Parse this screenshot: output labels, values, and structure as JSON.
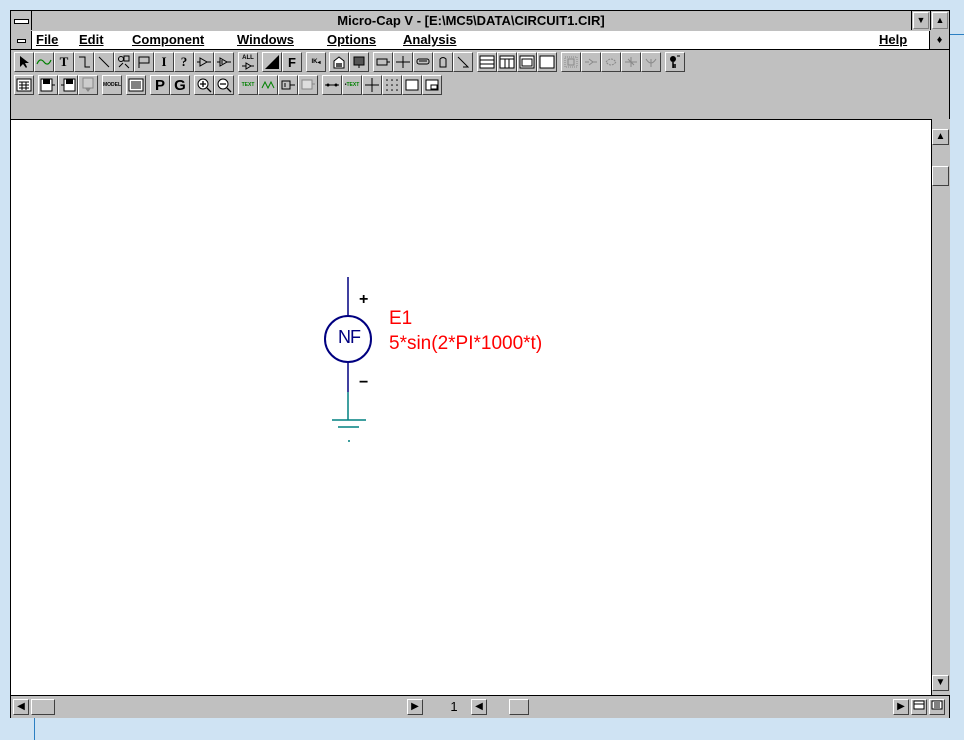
{
  "window": {
    "title": "Micro-Cap V - [E:\\MC5\\DATA\\CIRCUIT1.CIR]"
  },
  "menu": {
    "items": [
      {
        "label": "File"
      },
      {
        "label": "Edit"
      },
      {
        "label": "Component"
      },
      {
        "label": "Windows"
      },
      {
        "label": "Options"
      },
      {
        "label": "Analysis"
      }
    ],
    "help": "Help"
  },
  "toolbar1": {
    "icons": [
      "select-arrow-icon",
      "sine-wave-icon",
      "text-tool-icon",
      "wire-tool-icon",
      "diagonal-wire-icon",
      "component-icon",
      "flag-icon",
      "info-icon",
      "help-icon",
      "buffer-icon",
      "buffer-2-icon",
      "all-icon",
      "display-icon",
      "font-icon",
      "fill-icon",
      "nodes-icon",
      "bus-icon",
      "pin-icon",
      "junction-icon",
      "battery-icon",
      "capacitor-icon",
      "probe-icon",
      "window-1-icon",
      "window-2-icon",
      "window-3-icon",
      "window-4-icon",
      "grid-1-icon",
      "grid-2-icon",
      "grid-3-icon",
      "grid-4-icon",
      "grid-5-icon",
      "key-icon"
    ],
    "labels": {
      "text": "T",
      "info": "I",
      "help": "?",
      "font": "F",
      "all": "ALL",
      "ik": "IK"
    }
  },
  "toolbar2": {
    "icons": [
      "calculator-icon",
      "save-in-icon",
      "save-out-icon",
      "library-icon",
      "model-icon",
      "list-icon",
      "page-p-icon",
      "grid-g-icon",
      "zoom-in-icon",
      "zoom-out-icon",
      "text-a-icon",
      "pin-1-icon",
      "pin-2-icon",
      "image-icon",
      "node-line-icon",
      "text-b-icon",
      "cross-icon",
      "dots-icon",
      "frame-icon",
      "frame-2-icon"
    ],
    "labels": {
      "p": "P",
      "g": "G",
      "model": "MODEL",
      "text": "TEXT"
    }
  },
  "schematic": {
    "component": {
      "symbol": "NF",
      "name": "E1",
      "value": "5*sin(2*PI*1000*t)",
      "plus": "+",
      "minus": "−",
      "name_color": "#ff0000",
      "symbol_color": "#000080",
      "ground_color": "#008080"
    }
  },
  "scroll": {
    "page": "1"
  }
}
